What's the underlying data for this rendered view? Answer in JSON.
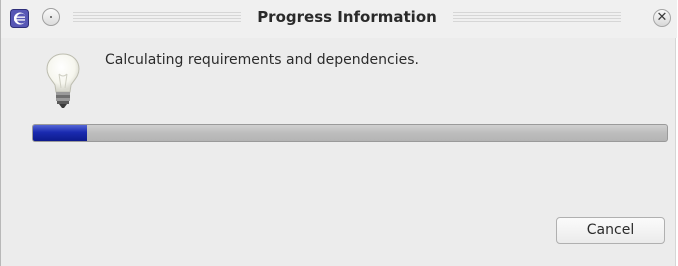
{
  "window": {
    "title": "Progress Information",
    "close_glyph": "✕"
  },
  "icons": {
    "app": "eclipse-app-icon",
    "menu": "window-menu-icon",
    "close": "close-icon",
    "info": "lightbulb-icon"
  },
  "dialog": {
    "message": "Calculating requirements and dependencies.",
    "progress_fraction": 0.085,
    "cancel_label": "Cancel"
  },
  "colors": {
    "progress_fill": "#1a2bb0",
    "app_icon": "#4a4aa8"
  }
}
